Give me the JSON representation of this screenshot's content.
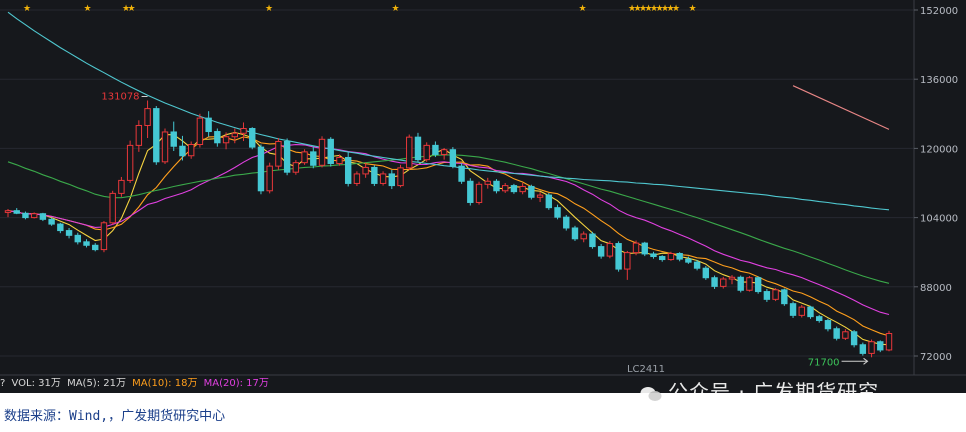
{
  "chart_data": {
    "type": "candlestick",
    "contract_label": "LC2411",
    "y_axis": {
      "ticks": [
        "152000",
        "136000",
        "120000",
        "104000",
        "88000",
        "72000"
      ],
      "ylim": [
        68600,
        154000
      ],
      "position": "right",
      "grid": true
    },
    "annotations": {
      "high_label": "131078",
      "low_label": "71700"
    },
    "ohlc": [
      [
        105200,
        106000,
        104100,
        105600
      ],
      [
        105600,
        106200,
        104800,
        105000
      ],
      [
        105000,
        105400,
        103600,
        104000
      ],
      [
        104000,
        105200,
        103800,
        104900
      ],
      [
        104900,
        105100,
        103200,
        103600
      ],
      [
        103600,
        104000,
        102100,
        102500
      ],
      [
        102500,
        102800,
        100400,
        101000
      ],
      [
        101000,
        101600,
        99200,
        99900
      ],
      [
        99900,
        100500,
        97800,
        98400
      ],
      [
        98400,
        99000,
        97100,
        97600
      ],
      [
        97600,
        98100,
        96200,
        96600
      ],
      [
        96600,
        103200,
        96000,
        102800
      ],
      [
        102800,
        110200,
        102400,
        109600
      ],
      [
        109600,
        113400,
        108800,
        112600
      ],
      [
        112600,
        121800,
        112000,
        120700
      ],
      [
        120700,
        126500,
        119200,
        125300
      ],
      [
        125300,
        131078,
        122400,
        129200
      ],
      [
        129200,
        129800,
        116200,
        116900
      ],
      [
        116900,
        124600,
        116400,
        123800
      ],
      [
        123800,
        126200,
        119400,
        120500
      ],
      [
        120500,
        122900,
        117200,
        118300
      ],
      [
        118300,
        121600,
        117600,
        120900
      ],
      [
        120900,
        128000,
        120200,
        127000
      ],
      [
        127000,
        128600,
        122700,
        123900
      ],
      [
        123900,
        124600,
        120400,
        121300
      ],
      [
        121300,
        123700,
        119800,
        122700
      ],
      [
        122700,
        124600,
        121200,
        123500
      ],
      [
        123500,
        126000,
        121700,
        124600
      ],
      [
        124600,
        124900,
        119800,
        120300
      ],
      [
        120300,
        120900,
        109400,
        110200
      ],
      [
        110200,
        116700,
        109600,
        115900
      ],
      [
        115900,
        122400,
        115100,
        121600
      ],
      [
        121600,
        122300,
        113800,
        114500
      ],
      [
        114500,
        117300,
        113900,
        116700
      ],
      [
        116700,
        119800,
        116200,
        119200
      ],
      [
        119200,
        120400,
        115400,
        116100
      ],
      [
        116100,
        122800,
        115600,
        122100
      ],
      [
        122100,
        122600,
        115800,
        116500
      ],
      [
        116500,
        118600,
        116000,
        117900
      ],
      [
        117900,
        119300,
        111200,
        111900
      ],
      [
        111900,
        114700,
        111300,
        114100
      ],
      [
        114100,
        116700,
        113200,
        115600
      ],
      [
        115600,
        116100,
        111300,
        111900
      ],
      [
        111900,
        114700,
        111400,
        114100
      ],
      [
        114100,
        115000,
        110600,
        111400
      ],
      [
        111400,
        116200,
        111000,
        115500
      ],
      [
        115500,
        123200,
        115000,
        122600
      ],
      [
        122600,
        123600,
        116800,
        117400
      ],
      [
        117400,
        121400,
        116900,
        120700
      ],
      [
        120700,
        121600,
        118000,
        118600
      ],
      [
        118600,
        120100,
        117400,
        119700
      ],
      [
        119700,
        120300,
        115400,
        115900
      ],
      [
        115900,
        116600,
        111800,
        112400
      ],
      [
        112400,
        113100,
        106800,
        107500
      ],
      [
        107500,
        112300,
        107000,
        111700
      ],
      [
        111700,
        113200,
        110700,
        112400
      ],
      [
        112400,
        112900,
        109600,
        110200
      ],
      [
        110200,
        112000,
        109700,
        111400
      ],
      [
        111400,
        111800,
        109500,
        110000
      ],
      [
        110000,
        112000,
        109400,
        111200
      ],
      [
        111200,
        111600,
        108200,
        108700
      ],
      [
        108700,
        109900,
        107600,
        109200
      ],
      [
        109200,
        109700,
        105800,
        106300
      ],
      [
        106300,
        107000,
        103600,
        104100
      ],
      [
        104100,
        104600,
        101000,
        101600
      ],
      [
        101600,
        102100,
        98600,
        99100
      ],
      [
        99100,
        100800,
        98300,
        100200
      ],
      [
        100200,
        100700,
        96800,
        97300
      ],
      [
        97300,
        97900,
        94500,
        95100
      ],
      [
        95100,
        98600,
        94600,
        98000
      ],
      [
        98000,
        98500,
        91500,
        92100
      ],
      [
        92100,
        96300,
        89600,
        95900
      ],
      [
        95900,
        98700,
        95300,
        98100
      ],
      [
        98100,
        98400,
        95100,
        95600
      ],
      [
        95600,
        96100,
        94500,
        95000
      ],
      [
        95000,
        95300,
        93800,
        94300
      ],
      [
        94300,
        96100,
        94000,
        95700
      ],
      [
        95700,
        96000,
        93900,
        94400
      ],
      [
        94400,
        95000,
        93300,
        93700
      ],
      [
        93700,
        94200,
        91800,
        92300
      ],
      [
        92300,
        92800,
        89600,
        90100
      ],
      [
        90100,
        90600,
        87500,
        88100
      ],
      [
        88100,
        90300,
        87600,
        89800
      ],
      [
        89800,
        90700,
        88600,
        90200
      ],
      [
        90200,
        90600,
        86700,
        87200
      ],
      [
        87200,
        90500,
        86900,
        90100
      ],
      [
        90100,
        90400,
        86400,
        86900
      ],
      [
        86900,
        87500,
        84500,
        85100
      ],
      [
        85100,
        87700,
        84700,
        87300
      ],
      [
        87300,
        87600,
        83600,
        84100
      ],
      [
        84100,
        84600,
        80800,
        81400
      ],
      [
        81400,
        83800,
        80900,
        83300
      ],
      [
        83300,
        83600,
        80600,
        81100
      ],
      [
        81100,
        81500,
        79700,
        80200
      ],
      [
        80200,
        80600,
        77700,
        78300
      ],
      [
        78300,
        78800,
        75600,
        76100
      ],
      [
        76100,
        78200,
        75700,
        77600
      ],
      [
        77600,
        78000,
        74000,
        74600
      ],
      [
        74600,
        75100,
        72100,
        72600
      ],
      [
        72600,
        75800,
        71700,
        75300
      ],
      [
        75300,
        75600,
        72900,
        73400
      ],
      [
        73400,
        77800,
        73100,
        77200
      ]
    ],
    "series": [
      {
        "name": "MA(5)",
        "color": "#f5d33f"
      },
      {
        "name": "MA(10)",
        "color": "#ff9f1c"
      },
      {
        "name": "MA(20)",
        "color": "#e040e0"
      },
      {
        "name": "",
        "color": "#3aa84a",
        "values": [
          116900,
          116200,
          115400,
          114700,
          113900,
          113200,
          112400,
          111700,
          110900,
          110200,
          109400,
          108900,
          108600,
          108600,
          108900,
          109300,
          109800,
          110300,
          110700,
          111200,
          111600,
          112000,
          112400,
          112700,
          113100,
          113400,
          113800,
          114000,
          114300,
          114500,
          114800,
          115000,
          115200,
          115400,
          115600,
          115700,
          115900,
          116000,
          116200,
          116300,
          116500,
          116700,
          116900,
          117100,
          117300,
          117500,
          117800,
          118000,
          118200,
          118400,
          118500,
          118500,
          118400,
          118200,
          118000,
          117600,
          117200,
          116800,
          116300,
          115800,
          115300,
          114700,
          114200,
          113600,
          113000,
          112400,
          111800,
          111200,
          110600,
          110100,
          109500,
          108900,
          108300,
          107700,
          107100,
          106500,
          105900,
          105300,
          104600,
          104000,
          103300,
          102600,
          101900,
          101200,
          100500,
          99800,
          99000,
          98300,
          97600,
          96900,
          96300,
          95600,
          94900,
          94200,
          93400,
          92700,
          91900,
          91200,
          90500,
          89900,
          89300,
          88800
        ]
      },
      {
        "name": "",
        "color": "#4fc7cf",
        "values": [
          151500,
          150000,
          148600,
          147200,
          145900,
          144600,
          143300,
          142100,
          140900,
          139700,
          138600,
          137500,
          136400,
          135300,
          134300,
          133300,
          132300,
          131400,
          130500,
          129700,
          128900,
          128100,
          127400,
          126700,
          126000,
          125400,
          124800,
          124200,
          123700,
          123200,
          122700,
          122200,
          121800,
          121400,
          121000,
          120600,
          120200,
          119900,
          119500,
          119200,
          118900,
          118500,
          118200,
          117900,
          117600,
          117300,
          117000,
          116800,
          116500,
          116300,
          116000,
          115800,
          115500,
          115300,
          115000,
          114800,
          114600,
          114400,
          114200,
          114000,
          113800,
          113600,
          113400,
          113300,
          113100,
          113000,
          112800,
          112700,
          112600,
          112500,
          112300,
          112200,
          112000,
          111900,
          111700,
          111600,
          111400,
          111200,
          111000,
          110800,
          110600,
          110400,
          110200,
          110000,
          109800,
          109600,
          109400,
          109200,
          108900,
          108700,
          108500,
          108200,
          108000,
          107700,
          107500,
          107200,
          107000,
          106700,
          106500,
          106200,
          106000,
          105800
        ]
      },
      {
        "name": "",
        "color": "#e88686",
        "x_range": [
          90,
          101
        ],
        "values": [
          134500,
          124400
        ]
      }
    ],
    "star_markers": [
      2,
      13,
      20,
      21,
      46,
      69,
      103,
      112,
      113,
      114,
      115,
      116,
      117,
      118,
      119,
      120,
      123
    ],
    "volume_bar": {
      "prefix": "?",
      "vol_label": "VOL: 31万",
      "ma5_label": "MA(5): 21万",
      "ma10_label": "MA(10): 18万",
      "ma20_label": "MA(20): 17万",
      "ma10_color": "#ff9f1c",
      "ma20_color": "#e040e0"
    }
  },
  "watermark": {
    "text": "公众号 · 广发期货研究"
  },
  "source_text": "数据来源：Wind,，广发期货研究中心",
  "colors": {
    "up": "#e8373a",
    "down": "#45c8d4",
    "background": "#16181c",
    "high_label": "#e8373a",
    "low_label": "#3cc35a"
  }
}
